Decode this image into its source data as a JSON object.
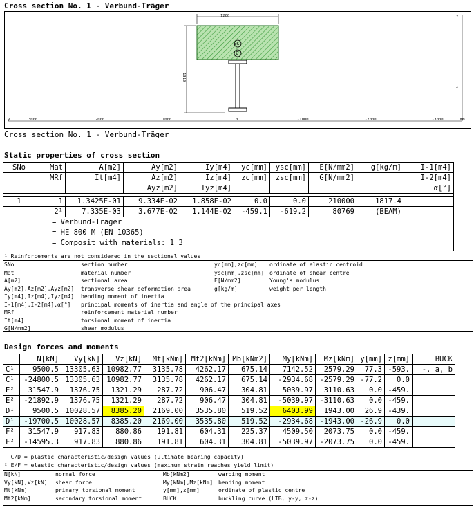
{
  "title_top": "Cross section No.    1 - Verbund-Träger",
  "caption": "Cross section No. 1 - Verbund-Träger",
  "drawing": {
    "dim_width": "1200",
    "dim_height": "1310",
    "label_sc": "SC",
    "label_c": "C",
    "x_ticks": [
      "3000.",
      "2000.",
      "1000.",
      "0.",
      "-1000.",
      "-2000.",
      "-3000."
    ],
    "x_unit": "mm",
    "y_label": "y",
    "z_label": "z",
    "y_axis_label": "y"
  },
  "static": {
    "title": "Static properties of cross section",
    "headers": [
      [
        "SNo",
        "Mat",
        "A[m2]",
        "Ay[m2]",
        "Iy[m4]",
        "yc[mm]",
        "ysc[mm]",
        "E[N/mm2]",
        "g[kg/m]",
        "I-1[m4]"
      ],
      [
        "",
        "MRf",
        "It[m4]",
        "Az[m2]",
        "Iz[m4]",
        "zc[mm]",
        "zsc[mm]",
        "G[N/mm2]",
        "",
        "I-2[m4]"
      ],
      [
        "",
        "",
        "",
        "Ayz[m2]",
        "Iyz[m4]",
        "",
        "",
        "",
        "",
        "α[°]"
      ]
    ],
    "rows": [
      [
        "1",
        "1",
        "1.3425E-01",
        "9.334E-02",
        "1.858E-02",
        "0.0",
        "0.0",
        "210000",
        "1817.4",
        ""
      ],
      [
        "",
        "2¹",
        "7.335E-03",
        "3.677E-02",
        "1.144E-02",
        "-459.1",
        "-619.2",
        "80769",
        "(BEAM)",
        ""
      ]
    ],
    "notes": [
      "=  Verbund-Träger",
      "=  HE 800 M (EN 10365)",
      "=  Composit with materials:   1   3"
    ],
    "footnote": "¹  Reinforcements are not considered in the sectional values",
    "legend_left": [
      [
        "SNo",
        "section number"
      ],
      [
        "Mat",
        "material number"
      ],
      [
        "A[m2]",
        "sectional area"
      ],
      [
        "Ay[m2],Az[m2],Ayz[m2]",
        "transverse shear deformation area"
      ],
      [
        "Iy[m4],Iz[m4],Iyz[m4]",
        "bending moment of inertia"
      ],
      [
        "I-1[m4],I-2[m4],α[°]",
        "principal moments of inertia and angle of the principal axes"
      ],
      [
        "MRf",
        "reinforcement material number"
      ],
      [
        "It[m4]",
        "torsional moment of inertia"
      ],
      [
        "G[N/mm2]",
        "shear modulus"
      ]
    ],
    "legend_right": [
      [
        "yc[mm],zc[mm]",
        "ordinate of elastic centroid"
      ],
      [
        "ysc[mm],zsc[mm]",
        "ordinate of shear centre"
      ],
      [
        "E[N/mm2]",
        "Young's modulus"
      ],
      [
        "g[kg/m]",
        "weight per length"
      ]
    ]
  },
  "design": {
    "title": "Design forces and moments",
    "headers": [
      "",
      "N[kN]",
      "Vy[kN]",
      "Vz[kN]",
      "Mt[kNm]",
      "Mt2[kNm]",
      "Mb[kNm2]",
      "My[kNm]",
      "Mz[kNm]",
      "y[mm]",
      "z[mm]",
      "BUCK"
    ],
    "rows": [
      [
        "C¹",
        "9500.5",
        "13305.63",
        "10982.77",
        "3135.78",
        "4262.17",
        "675.14",
        "7142.52",
        "2579.29",
        "77.3",
        "-593.",
        "-, a, b"
      ],
      [
        "C¹",
        "-24800.5",
        "13305.63",
        "10982.77",
        "3135.78",
        "4262.17",
        "675.14",
        "-2934.68",
        "-2579.29",
        "-77.2",
        "0.0",
        ""
      ],
      [
        "E²",
        "31547.9",
        "1376.75",
        "1321.29",
        "287.72",
        "906.47",
        "304.81",
        "5039.97",
        "3110.63",
        "0.0",
        "-459.",
        ""
      ],
      [
        "E²",
        "-21892.9",
        "1376.75",
        "1321.29",
        "287.72",
        "906.47",
        "304.81",
        "-5039.97",
        "-3110.63",
        "0.0",
        "-459.",
        ""
      ],
      [
        "D¹",
        "9500.5",
        "10028.57",
        "8385.20",
        "2169.00",
        "3535.80",
        "519.52",
        "6403.99",
        "1943.00",
        "26.9",
        "-439.",
        ""
      ],
      [
        "D¹",
        "-19700.5",
        "10028.57",
        "8385.20",
        "2169.00",
        "3535.80",
        "519.52",
        "-2934.68",
        "-1943.00",
        "-26.9",
        "0.0",
        ""
      ],
      [
        "F²",
        "31547.9",
        "917.83",
        "880.86",
        "191.81",
        "604.31",
        "225.37",
        "4509.50",
        "2073.75",
        "0.0",
        "-459.",
        ""
      ],
      [
        "F²",
        "-14595.3",
        "917.83",
        "880.86",
        "191.81",
        "604.31",
        "304.81",
        "-5039.97",
        "-2073.75",
        "0.0",
        "-459.",
        ""
      ]
    ],
    "footnotes": [
      "¹  C/D = plastic characteristic/design values (ultimate bearing capacity)",
      "²  E/F = elastic characteristic/design values (maximum strain reaches yield limit)"
    ],
    "legend_left": [
      [
        "N[kN]",
        "normal force"
      ],
      [
        "Vy[kN],Vz[kN]",
        "shear force"
      ],
      [
        "Mt[kNm]",
        "primary torsional moment"
      ],
      [
        "Mt2[kNm]",
        "secondary torsional moment"
      ]
    ],
    "legend_right": [
      [
        "Mb[kNm2]",
        "warping moment"
      ],
      [
        "My[kNm],Mz[kNm]",
        "bending moment"
      ],
      [
        "y[mm],z[mm]",
        "ordinate of plastic centre"
      ],
      [
        "BUCK",
        "buckling curve (LTB, y-y, z-z)"
      ]
    ]
  }
}
